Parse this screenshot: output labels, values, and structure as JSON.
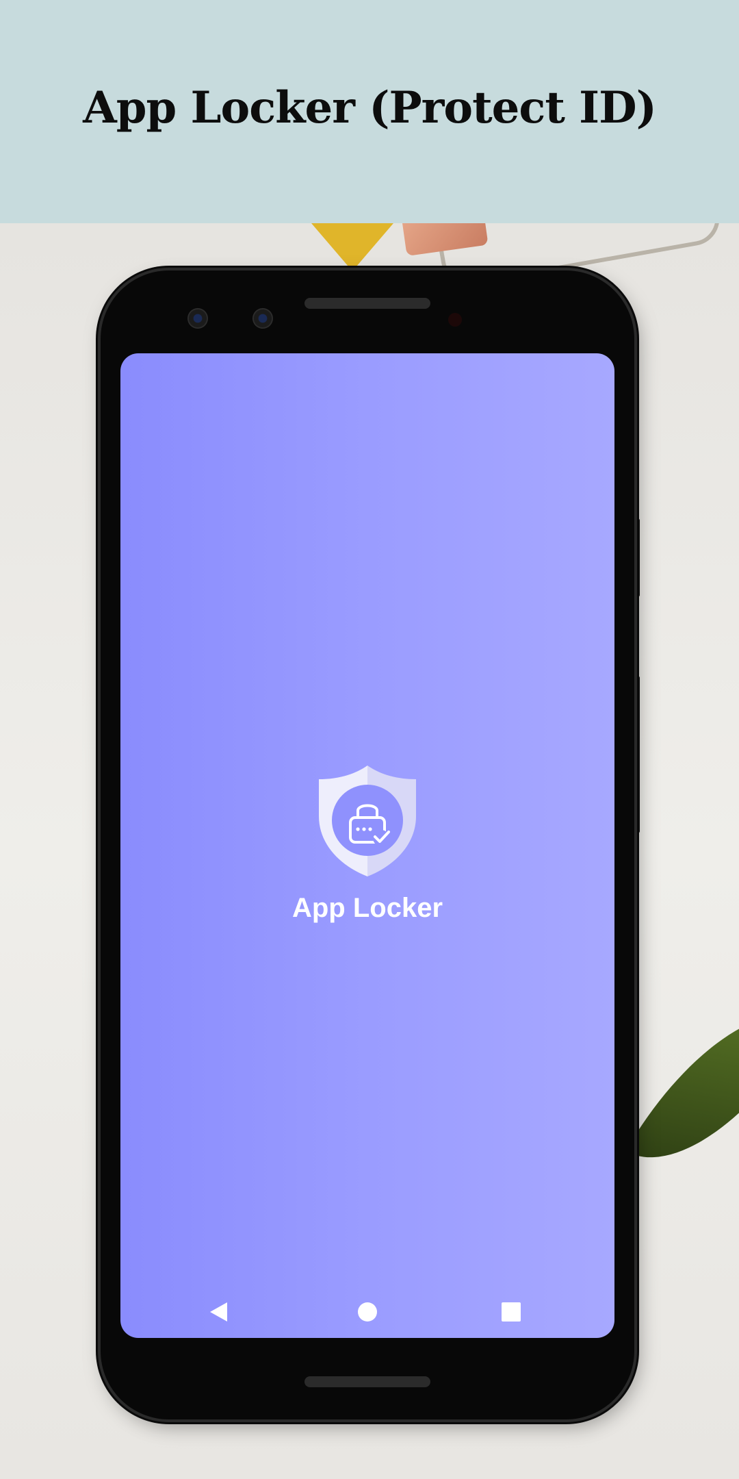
{
  "banner": {
    "title": "App Locker (Protect ID)"
  },
  "screen": {
    "app_name": "App Locker",
    "logo_icon": "shield-lock-icon",
    "gradient_colors": [
      "#8a8cfd",
      "#a7a8ff"
    ]
  },
  "navbar": {
    "items": [
      {
        "icon": "back-triangle-icon"
      },
      {
        "icon": "home-circle-icon"
      },
      {
        "icon": "recents-square-icon"
      }
    ]
  },
  "colors": {
    "banner_bg": "#c7dbdd",
    "text_dark": "#0d0d0d",
    "screen_text": "#ffffff"
  }
}
